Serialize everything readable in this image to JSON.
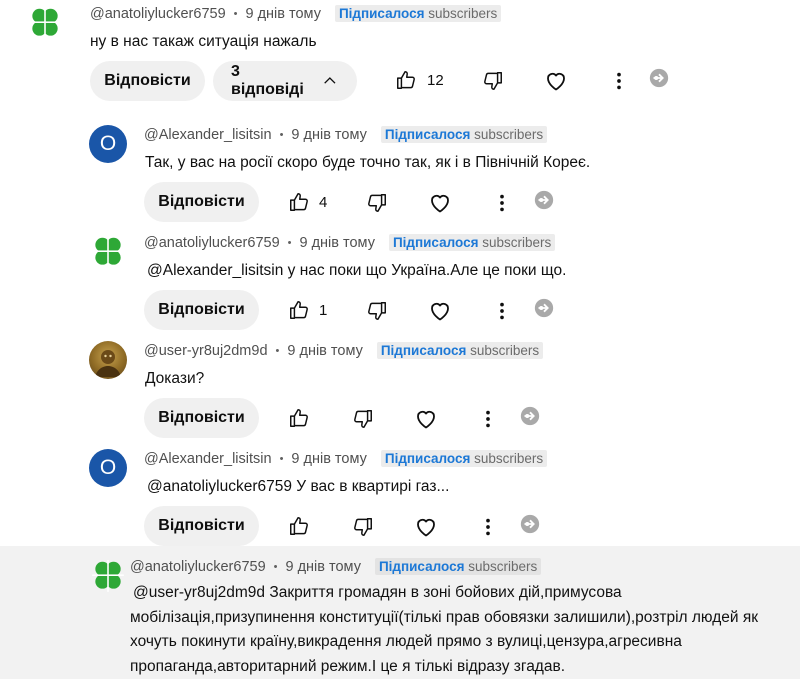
{
  "subscribed": {
    "label_uk": "Підписалося",
    "label_en": "subscribers"
  },
  "reply_label": "Відповісти",
  "comments": [
    {
      "handle": "@anatoliylucker6759",
      "time": "9 днів тому",
      "avatar": "clover-icon",
      "text": "ну в нас такаж ситуація нажаль",
      "likes": "12",
      "replies_label": "3 відповіді"
    },
    {
      "handle": "@Alexander_lisitsin",
      "time": "9 днів тому",
      "avatar": "O",
      "text": "Так, у вас на росії скоро буде точно так, як і в Північній Кореє.",
      "likes": "4"
    },
    {
      "handle": "@anatoliylucker6759",
      "time": "9 днів тому",
      "avatar": "clover-icon",
      "mention": "@Alexander_lisitsin",
      "text": " у нас поки що Україна.Але це поки що.",
      "likes": "1"
    },
    {
      "handle": "@user-yr8uj2dm9d",
      "time": "9 днів тому",
      "avatar": "photo",
      "text": "Докази?",
      "likes": ""
    },
    {
      "handle": "@Alexander_lisitsin",
      "time": "9 днів тому",
      "avatar": "O",
      "mention": "@anatoliylucker6759",
      "text": " У вас в квартирі газ...",
      "likes": ""
    },
    {
      "handle": "@anatoliylucker6759",
      "time": "9 днів тому",
      "avatar": "clover-icon",
      "mention": "@user-yr8uj2dm9d",
      "lines": [
        " Закриття громадян в зоні бойових дій,примусова",
        "мобілізація,призупинення конституції(тількі прав обовязки залишили),розтріл людей як",
        "хочуть покинути країну,викрадення людей прямо з вулиці,цензура,агресивна",
        "пропаганда,авторитарний режим.І це я тількі відразу згадав."
      ]
    }
  ]
}
